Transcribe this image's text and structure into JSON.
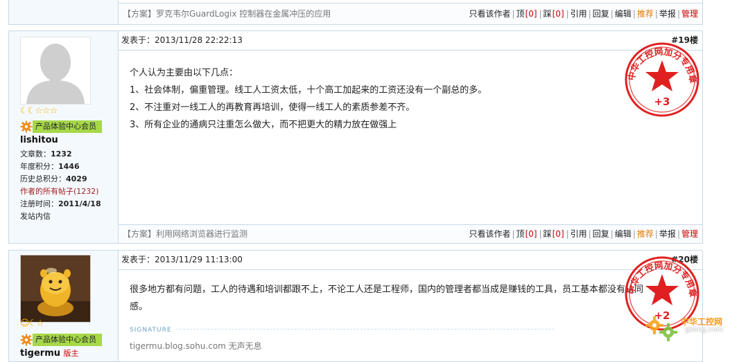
{
  "prev_post": {
    "solution_link": "【方案】罗克韦尔GuardLogix 控制器在金属冲压的应用",
    "actions": {
      "only_author": "只看该作者",
      "top": "顶",
      "top_count": "[0]",
      "step": "踩",
      "step_count": "[0]",
      "quote": "引用",
      "reply": "回复",
      "edit": "编辑",
      "recommend": "推荐",
      "report": "举报",
      "manage": "管理"
    }
  },
  "posts": [
    {
      "user": {
        "name": "lishitou",
        "rank_icons": "☾☾☆☆☆",
        "group": "产品体验中心会员",
        "posts_label": "文章数：",
        "posts_value": "1232",
        "annual_label": "年度积分：",
        "annual_value": "1446",
        "total_label": "历史总积分：",
        "total_value": "4029",
        "all_posts_link": "作者的所有帖子(1232)",
        "reg_label": "注册时间：",
        "reg_value": "2011/4/18",
        "pm_link": "发站内信"
      },
      "posted_at": "发表于：2013/11/28 22:22:13",
      "floor": "#19楼",
      "content": [
        "个人认为主要由以下几点：",
        "1、社会体制，偏重管理。线工人工资太低，十个高工加起来的工资还没有一个副总的多。",
        "2、不注重对一线工人的再教育再培训，使得一线工人的素质参差不齐。",
        "3、所有企业的通病只注重怎么做大，而不把更大的精力放在做强上"
      ],
      "stamp": {
        "text": "中华工控网加分专用章",
        "points": "+3"
      },
      "solution_link": "【方案】利用网络浏览器进行监测",
      "actions": {
        "only_author": "只看该作者",
        "top": "顶",
        "top_count": "[0]",
        "step": "踩",
        "step_count": "[0]",
        "quote": "引用",
        "reply": "回复",
        "edit": "编辑",
        "recommend": "推荐",
        "report": "举报",
        "manage": "管理"
      }
    },
    {
      "user": {
        "name": "tigermu",
        "name_suffix": "版主",
        "rank_icons": "☺☾☆",
        "group": "产品体验中心会员"
      },
      "posted_at": "发表于：2013/11/29 11:13:00",
      "floor": "#20楼",
      "content": [
        "很多地方都有问题，工人的待遇和培训都跟不上，不论工人还是工程师，国内的管理者都当成是赚钱的工具，员工基本都没有认同",
        "感。"
      ],
      "signature_label": "SIGNATURE",
      "signature": "tigermu.blog.sohu.com   无声无息",
      "stamp": {
        "text": "中华工控网加分专用章",
        "points": "+2"
      }
    }
  ],
  "watermark": {
    "cn": "中华工控网",
    "url": "gkong.com"
  },
  "colors": {
    "border": "#c7d9e8",
    "sidebar_bg": "#f4f9fd",
    "stamp_red": "#e02020",
    "group_green": "#a6d84a",
    "link_orange": "#e87a00"
  }
}
